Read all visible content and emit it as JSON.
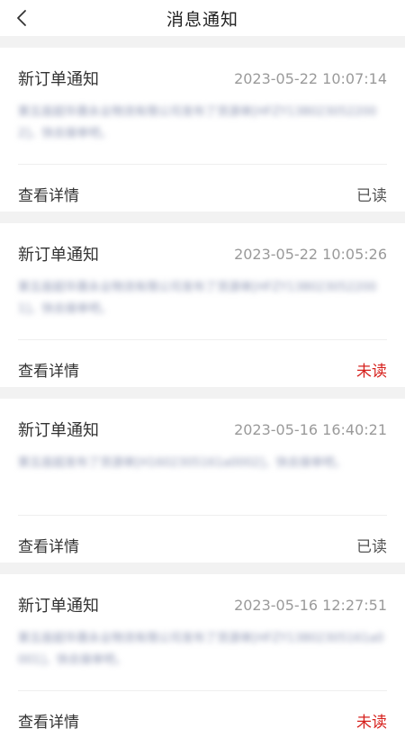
{
  "header": {
    "title": "消息通知"
  },
  "messages": [
    {
      "title": "新订单通知",
      "time": "2023-05-22 10:07:14",
      "content": "第五座超华晟永业物流有限公司发布了货源单[HFZY1380230522002]，快去接单吧。",
      "detail_label": "查看详情",
      "status": "已读",
      "status_color": "#555555"
    },
    {
      "title": "新订单通知",
      "time": "2023-05-22 10:05:26",
      "content": "第五座超华晟永业物流有限公司发布了货源单[HFZY1380230522001]，快去接单吧。",
      "detail_label": "查看详情",
      "status": "未读",
      "status_color": "#d6201c"
    },
    {
      "title": "新订单通知",
      "time": "2023-05-16 16:40:21",
      "content": "第五座超发布了货源单[H1602305161a0002]，快去接单吧。",
      "detail_label": "查看详情",
      "status": "已读",
      "status_color": "#555555"
    },
    {
      "title": "新订单通知",
      "time": "2023-05-16 12:27:51",
      "content": "第五座超华晟永业物流有限公司发布了货源单[HFZY13802305161a0001]，快去接单吧。",
      "detail_label": "查看详情",
      "status": "未读",
      "status_color": "#d6201c"
    }
  ]
}
